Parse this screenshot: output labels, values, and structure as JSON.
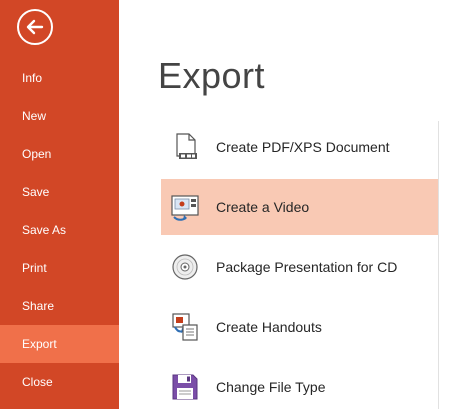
{
  "sidebar": {
    "back_label": "",
    "items": [
      {
        "label": "Info"
      },
      {
        "label": "New"
      },
      {
        "label": "Open"
      },
      {
        "label": "Save"
      },
      {
        "label": "Save As"
      },
      {
        "label": "Print"
      },
      {
        "label": "Share"
      },
      {
        "label": "Export",
        "selected": true
      },
      {
        "label": "Close"
      }
    ]
  },
  "main": {
    "title": "Export",
    "options": [
      {
        "label": "Create PDF/XPS Document",
        "icon": "pdf-document-icon"
      },
      {
        "label": "Create a Video",
        "icon": "video-icon",
        "selected": true
      },
      {
        "label": "Package Presentation for CD",
        "icon": "cd-icon"
      },
      {
        "label": "Create Handouts",
        "icon": "handouts-icon"
      },
      {
        "label": "Change File Type",
        "icon": "floppy-disk-icon"
      }
    ]
  },
  "colors": {
    "sidebar_bg": "#d24726",
    "sidebar_selected": "#f0704a",
    "option_selected": "#f9c9b4"
  }
}
